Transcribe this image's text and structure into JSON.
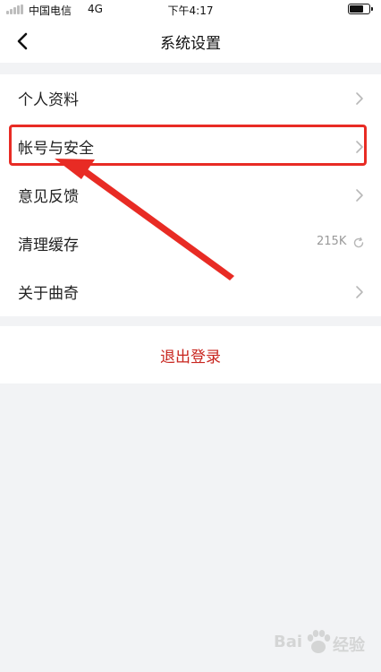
{
  "status_bar": {
    "carrier": "中国电信",
    "network": "4G",
    "time": "下午4:17"
  },
  "nav": {
    "title": "系统设置",
    "back_icon": "chevron-left-icon"
  },
  "settings": {
    "items": [
      {
        "label": "个人资料",
        "icon": "chevron-right-icon"
      },
      {
        "label": "帐号与安全",
        "icon": "chevron-right-icon"
      },
      {
        "label": "意见反馈",
        "icon": "chevron-right-icon"
      },
      {
        "label": "清理缓存",
        "value": "215K",
        "icon": "refresh-icon"
      },
      {
        "label": "关于曲奇",
        "icon": "chevron-right-icon"
      }
    ]
  },
  "logout": {
    "label": "退出登录"
  },
  "watermark": {
    "text_left": "Bai",
    "text_right": "经验"
  },
  "colors": {
    "accent_red": "#c8261f",
    "highlight_red": "#e82b24",
    "background": "#f2f3f5"
  }
}
